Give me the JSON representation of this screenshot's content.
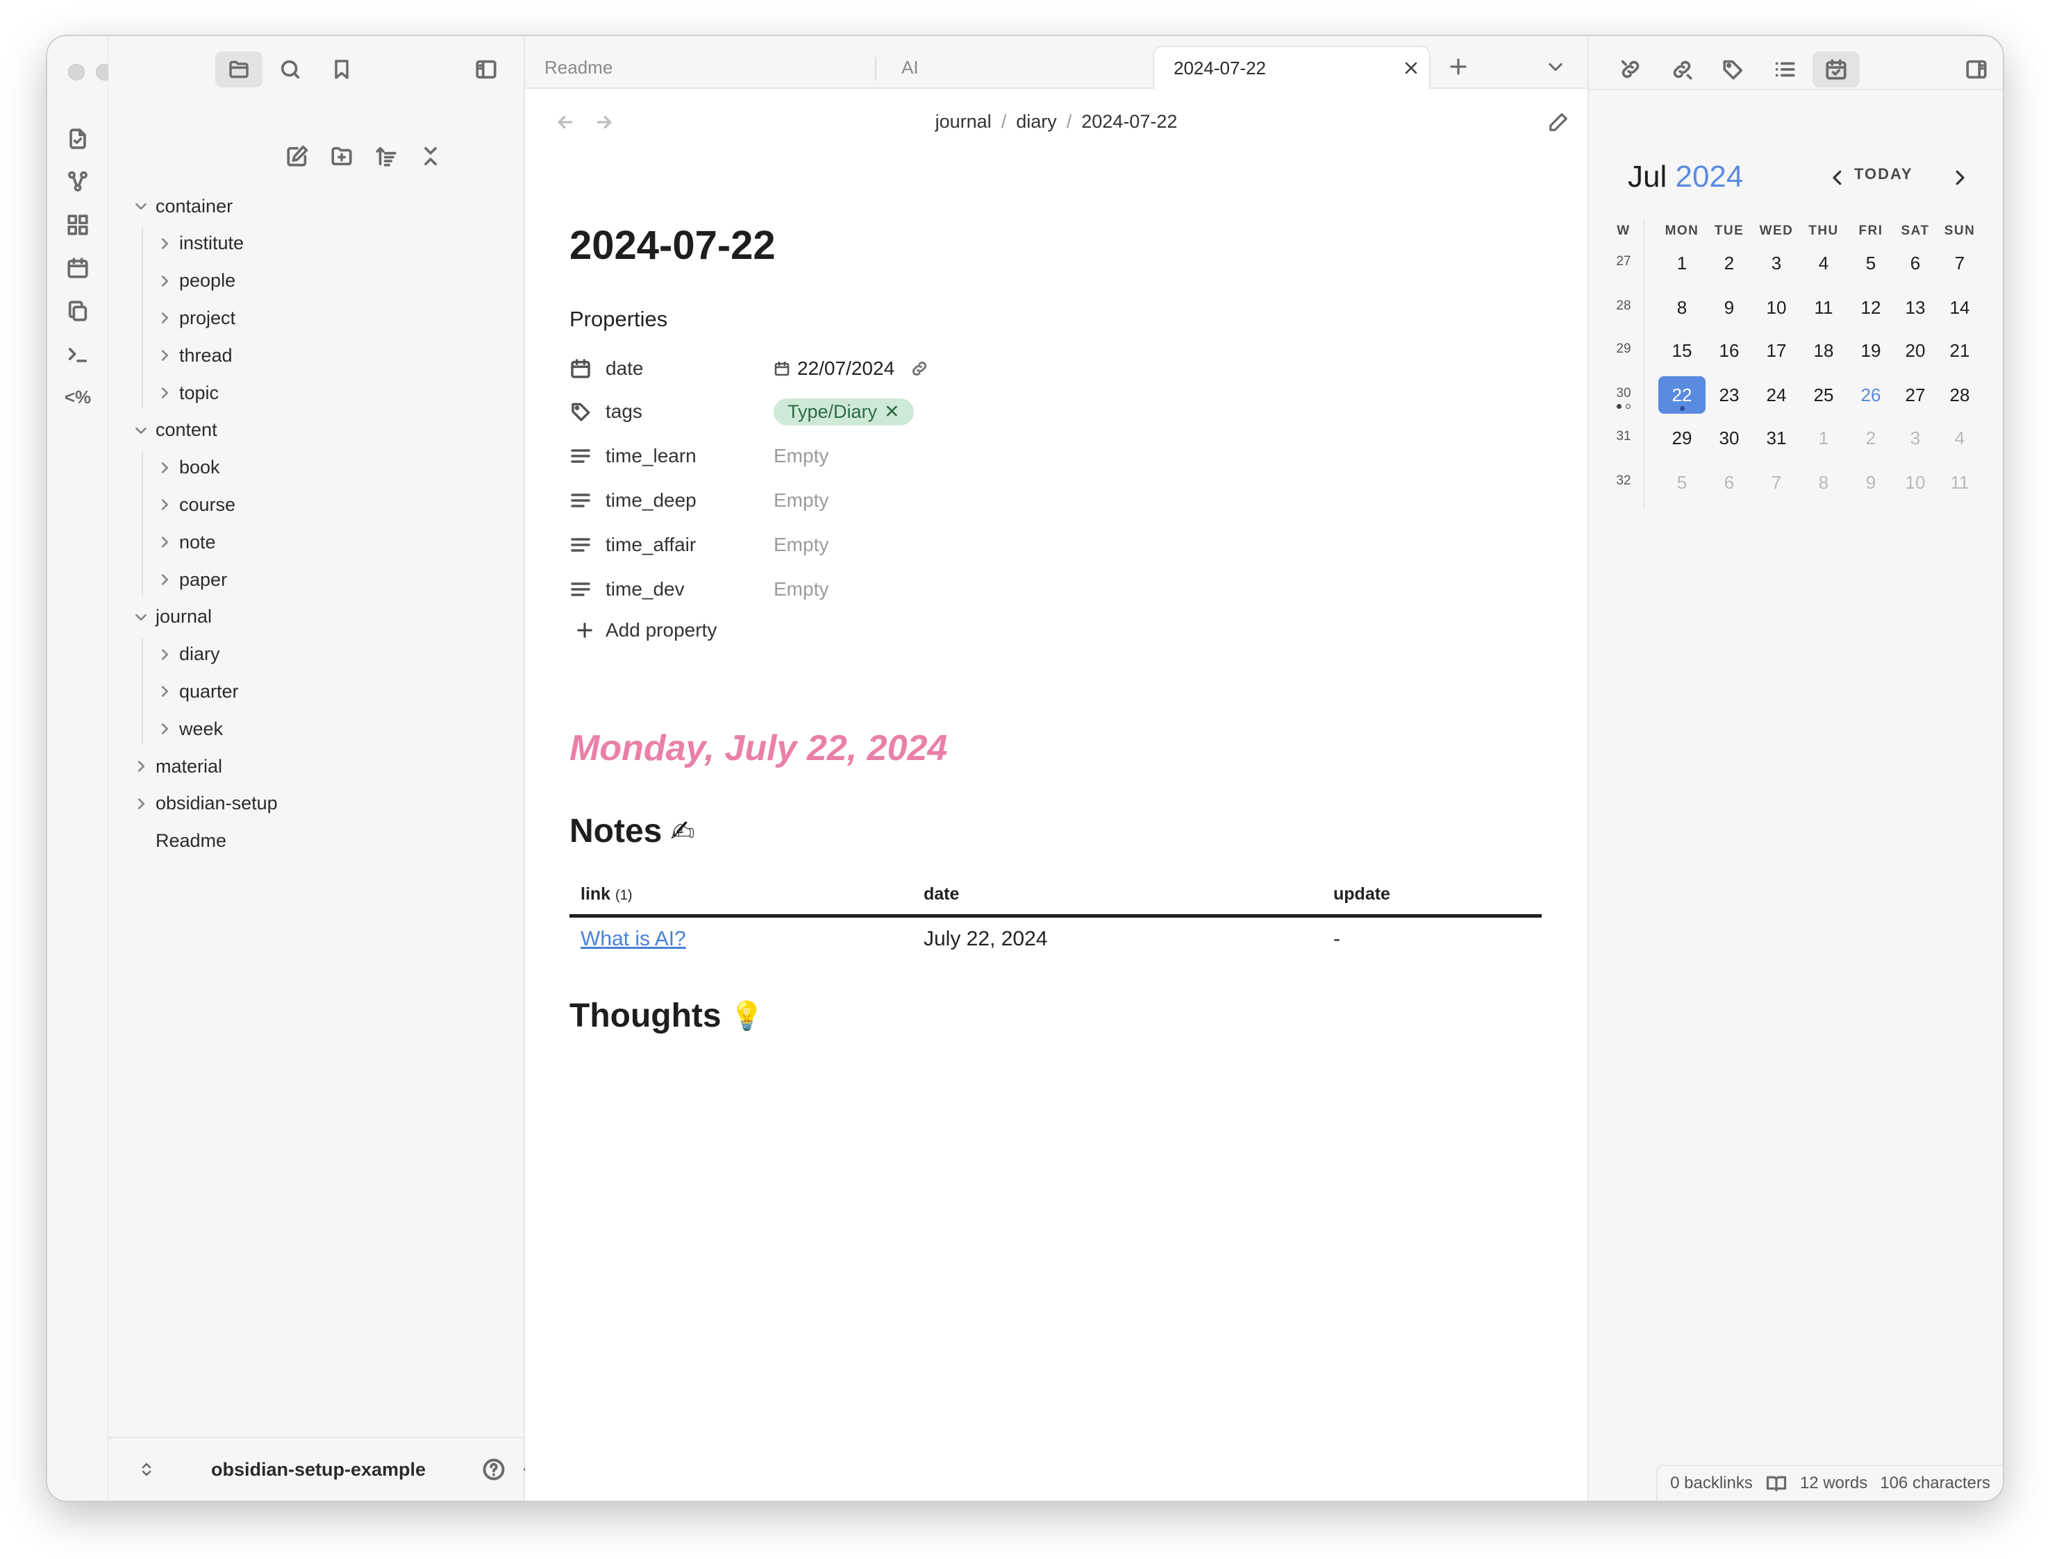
{
  "sidebar": {
    "tree": [
      {
        "label": "container",
        "depth": 0,
        "expanded": true
      },
      {
        "label": "institute",
        "depth": 1,
        "expanded": false
      },
      {
        "label": "people",
        "depth": 1,
        "expanded": false
      },
      {
        "label": "project",
        "depth": 1,
        "expanded": false
      },
      {
        "label": "thread",
        "depth": 1,
        "expanded": false
      },
      {
        "label": "topic",
        "depth": 1,
        "expanded": false
      },
      {
        "label": "content",
        "depth": 0,
        "expanded": true
      },
      {
        "label": "book",
        "depth": 1,
        "expanded": false
      },
      {
        "label": "course",
        "depth": 1,
        "expanded": false
      },
      {
        "label": "note",
        "depth": 1,
        "expanded": false
      },
      {
        "label": "paper",
        "depth": 1,
        "expanded": false
      },
      {
        "label": "journal",
        "depth": 0,
        "expanded": true
      },
      {
        "label": "diary",
        "depth": 1,
        "expanded": false
      },
      {
        "label": "quarter",
        "depth": 1,
        "expanded": false
      },
      {
        "label": "week",
        "depth": 1,
        "expanded": false
      },
      {
        "label": "material",
        "depth": 0,
        "expanded": false
      },
      {
        "label": "obsidian-setup",
        "depth": 0,
        "expanded": false
      },
      {
        "label": "Readme",
        "depth": 0,
        "file": true
      }
    ],
    "vault_name": "obsidian-setup-example"
  },
  "tabs": [
    {
      "label": "Readme",
      "active": false
    },
    {
      "label": "AI",
      "active": false
    },
    {
      "label": "2024-07-22",
      "active": true
    }
  ],
  "breadcrumb": {
    "parts": [
      "journal",
      "diary",
      "2024-07-22"
    ],
    "separator": "/"
  },
  "doc": {
    "title": "2024-07-22",
    "properties_heading": "Properties",
    "properties": [
      {
        "icon": "calendar-icon",
        "name": "date",
        "value": "22/07/2024",
        "type": "date"
      },
      {
        "icon": "tag-icon",
        "name": "tags",
        "value": "Type/Diary",
        "type": "tags"
      },
      {
        "icon": "text-lines-icon",
        "name": "time_learn",
        "value": "Empty",
        "type": "text"
      },
      {
        "icon": "text-lines-icon",
        "name": "time_deep",
        "value": "Empty",
        "type": "text"
      },
      {
        "icon": "text-lines-icon",
        "name": "time_affair",
        "value": "Empty",
        "type": "text"
      },
      {
        "icon": "text-lines-icon",
        "name": "time_dev",
        "value": "Empty",
        "type": "text"
      }
    ],
    "add_property": "Add property",
    "big_date": "Monday, July 22, 2024",
    "notes_heading": "Notes",
    "notes_emoji": "✍",
    "table": {
      "headers": {
        "link": "link",
        "link_count": "(1)",
        "date": "date",
        "update": "update"
      },
      "rows": [
        {
          "link": "What is AI?",
          "date": "July 22, 2024",
          "update": "-"
        }
      ]
    },
    "thoughts_heading": "Thoughts",
    "thoughts_emoji": "💡"
  },
  "calendar": {
    "month": "Jul",
    "year": "2024",
    "today_label": "TODAY",
    "week_header": "W",
    "day_headers": [
      "MON",
      "TUE",
      "WED",
      "THU",
      "FRI",
      "SAT",
      "SUN"
    ],
    "weeks": [
      {
        "w": "27",
        "days": [
          [
            "1",
            0
          ],
          [
            "2",
            0
          ],
          [
            "3",
            0
          ],
          [
            "4",
            0
          ],
          [
            "5",
            0
          ],
          [
            "6",
            0
          ],
          [
            "7",
            0
          ]
        ]
      },
      {
        "w": "28",
        "days": [
          [
            "8",
            0
          ],
          [
            "9",
            0
          ],
          [
            "10",
            0
          ],
          [
            "11",
            0
          ],
          [
            "12",
            0
          ],
          [
            "13",
            0
          ],
          [
            "14",
            0
          ]
        ]
      },
      {
        "w": "29",
        "days": [
          [
            "15",
            0
          ],
          [
            "16",
            0
          ],
          [
            "17",
            0
          ],
          [
            "18",
            0
          ],
          [
            "19",
            0
          ],
          [
            "20",
            0
          ],
          [
            "21",
            0
          ]
        ]
      },
      {
        "w": "30",
        "days": [
          [
            "22",
            2
          ],
          [
            "23",
            0
          ],
          [
            "24",
            0
          ],
          [
            "25",
            0
          ],
          [
            "26",
            3
          ],
          [
            "27",
            0
          ],
          [
            "28",
            0
          ]
        ]
      },
      {
        "w": "31",
        "days": [
          [
            "29",
            0
          ],
          [
            "30",
            0
          ],
          [
            "31",
            0
          ],
          [
            "1",
            1
          ],
          [
            "2",
            1
          ],
          [
            "3",
            1
          ],
          [
            "4",
            1
          ]
        ]
      },
      {
        "w": "32",
        "days": [
          [
            "5",
            1
          ],
          [
            "6",
            1
          ],
          [
            "7",
            1
          ],
          [
            "8",
            1
          ],
          [
            "9",
            1
          ],
          [
            "10",
            1
          ],
          [
            "11",
            1
          ]
        ]
      }
    ],
    "accent_color": "#5a8be0"
  },
  "status": {
    "backlinks": "0 backlinks",
    "words": "12 words",
    "characters": "106 characters"
  },
  "colors": {
    "heading_pink": "#ea7fa8",
    "tag_bg": "#cfe9d7",
    "link_blue": "#4a7fdb"
  }
}
